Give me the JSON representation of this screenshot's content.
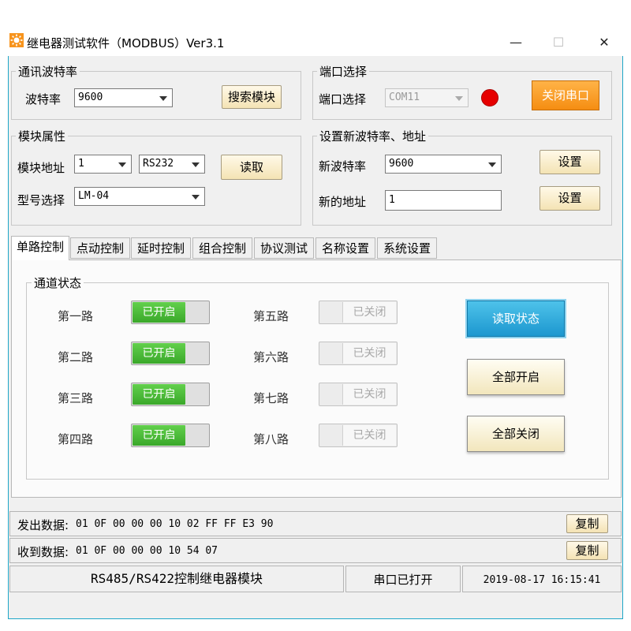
{
  "window": {
    "title": "继电器测试软件（MODBUS）Ver3.1",
    "minimize_icon": "minimize-icon",
    "maximize_icon": "maximize-icon",
    "close_icon": "close-icon",
    "close_glyph": "✕",
    "minimize_glyph": "—",
    "maximize_glyph": "☐",
    "border_color": "#1ea7c8"
  },
  "baud_group": {
    "legend": "通讯波特率",
    "label": "波特率",
    "value": "9600",
    "search_button": "搜索模块"
  },
  "port_group": {
    "legend": "端口选择",
    "label": "端口选择",
    "value": "COM11",
    "indicator_color": "#e60000",
    "close_port_button": "关闭串口"
  },
  "module_group": {
    "legend": "模块属性",
    "address_label": "模块地址",
    "address_value": "1",
    "protocol_value": "RS232",
    "read_button": "读取",
    "model_label": "型号选择",
    "model_value": "LM-04"
  },
  "new_settings_group": {
    "legend": "设置新波特率、地址",
    "baud_label": "新波特率",
    "baud_value": "9600",
    "set_baud_button": "设置",
    "address_label": "新的地址",
    "address_value": "1",
    "set_address_button": "设置"
  },
  "tabs": [
    {
      "label": "单路控制",
      "active": true
    },
    {
      "label": "点动控制"
    },
    {
      "label": "延时控制"
    },
    {
      "label": "组合控制"
    },
    {
      "label": "协议测试"
    },
    {
      "label": "名称设置"
    },
    {
      "label": "系统设置"
    }
  ],
  "channel_panel": {
    "legend": "通道状态",
    "channels": [
      {
        "name": "第一路",
        "state": "已开启",
        "on": true
      },
      {
        "name": "第二路",
        "state": "已开启",
        "on": true
      },
      {
        "name": "第三路",
        "state": "已开启",
        "on": true
      },
      {
        "name": "第四路",
        "state": "已开启",
        "on": true
      },
      {
        "name": "第五路",
        "state": "已关闭",
        "on": false
      },
      {
        "name": "第六路",
        "state": "已关闭",
        "on": false
      },
      {
        "name": "第七路",
        "state": "已关闭",
        "on": false
      },
      {
        "name": "第八路",
        "state": "已关闭",
        "on": false
      }
    ],
    "read_status_button": "读取状态",
    "all_on_button": "全部开启",
    "all_off_button": "全部关闭"
  },
  "data_log": {
    "sent_label": "发出数据:",
    "sent_value": "01 0F 00 00 00 10 02 FF FF E3 90",
    "received_label": "收到数据:",
    "received_value": "01 0F 00 00 00 10 54 07",
    "copy_button": "复制"
  },
  "status_bar": {
    "description": "RS485/RS422控制继电器模块",
    "port_status": "串口已打开",
    "datetime": "2019-08-17 16:15:41"
  }
}
